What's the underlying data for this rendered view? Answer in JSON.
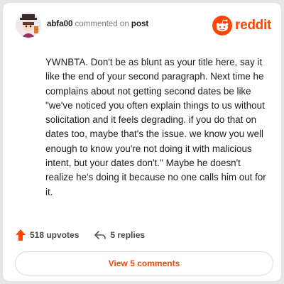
{
  "header": {
    "username": "abfa00",
    "commented_on_text": "commented on",
    "post_link": "post",
    "brand_wordmark": "reddit"
  },
  "comment": {
    "text": "YWNBTA. Don't be as blunt as your title here, say it like the end of your second paragraph. Next time he complains about not getting second dates be like \"we've noticed you often explain things to us without solicitation and it feels degrading. if you do that on dates too, maybe that's the issue. we know you well enough to know you're not doing it with malicious intent, but your dates don't.\" Maybe he doesn't realize he's doing it because no one calls him out for it."
  },
  "actions": {
    "upvotes": "518 upvotes",
    "replies": "5 replies"
  },
  "footer": {
    "view_comments": "View 5 comments"
  },
  "colors": {
    "brand": "#ff4500",
    "link": "#e84b0d",
    "upvote": "#ff4500"
  },
  "icons": [
    "avatar",
    "reddit-snoo-icon",
    "upvote-arrow-icon",
    "reply-icon"
  ]
}
